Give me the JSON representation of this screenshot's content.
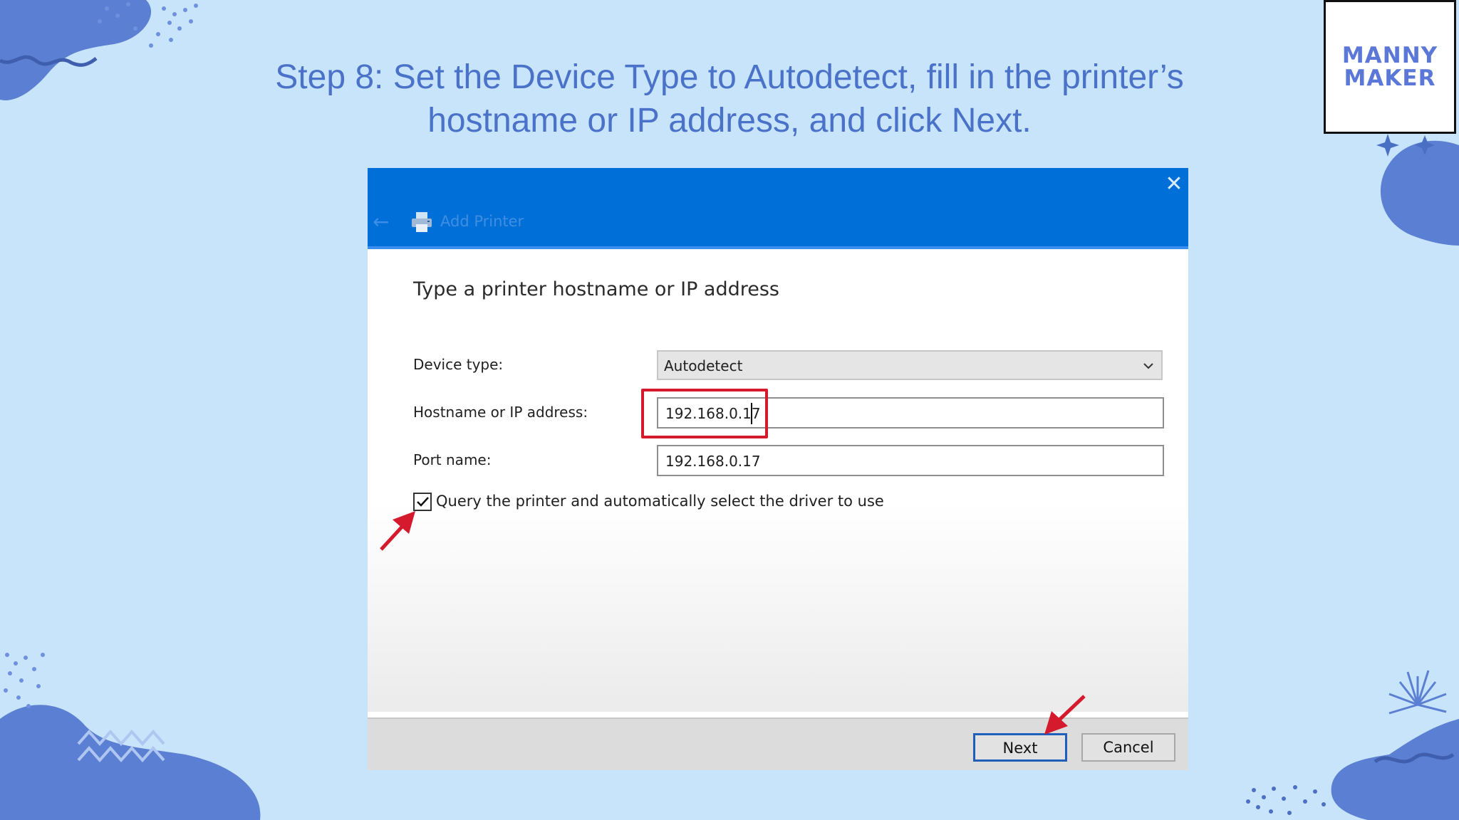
{
  "slide": {
    "title_line1": "Step 8: Set the Device Type to Autodetect, fill in the printer’s",
    "title_line2": "hostname or IP address, and click Next."
  },
  "logo": {
    "line1": "MANNY",
    "line2": "MAKER"
  },
  "dialog": {
    "title": "Add Printer",
    "close_label": "✕",
    "back_icon": "back-arrow-icon",
    "heading": "Type a printer hostname or IP address",
    "device_type_label": "Device type:",
    "device_type_value": "Autodetect",
    "hostname_label": "Hostname or IP address:",
    "hostname_value": "192.168.0.17",
    "port_label": "Port name:",
    "port_value": "192.168.0.17",
    "query_label": "Query the printer and automatically select the driver to use",
    "query_checked": true,
    "next_label": "Next",
    "cancel_label": "Cancel"
  },
  "colors": {
    "background": "#c8e4fb",
    "title_text": "#4b72c9",
    "titlebar": "#0070d8",
    "annotation_red": "#d41a2c",
    "decoration_blue": "#5577c9"
  }
}
